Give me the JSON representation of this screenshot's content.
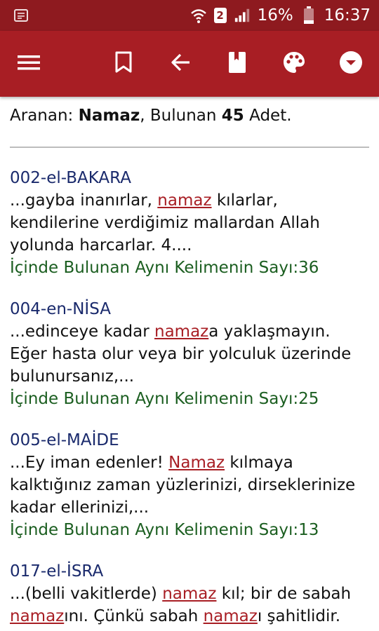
{
  "status_bar": {
    "battery": "16%",
    "time": "16:37",
    "sim": "2",
    "icons": [
      "notification-icon",
      "wifi-icon",
      "signal-icon",
      "battery-icon"
    ]
  },
  "toolbar": {
    "icons": [
      "menu-icon",
      "bookmark-icon",
      "back-arrow-icon",
      "book-icon",
      "palette-icon",
      "dropdown-icon"
    ]
  },
  "search": {
    "label_searched": "Aranan:",
    "term": "Namaz",
    "label_found": ", Bulunan",
    "count": "45",
    "unit": "Adet."
  },
  "results": [
    {
      "title": "002-el-BAKARA",
      "text": [
        {
          "t": "...gayba inanırlar, ",
          "h": false
        },
        {
          "t": "namaz",
          "h": true
        },
        {
          "t": " kılarlar, kendilerine verdiğimiz mallardan Allah yolunda harcarlar. 4....",
          "h": false
        }
      ],
      "count": "İçinde Bulunan Aynı Kelimenin Sayı:36"
    },
    {
      "title": "004-en-NİSA",
      "text": [
        {
          "t": "...edinceye kadar ",
          "h": false
        },
        {
          "t": "namaz",
          "h": true
        },
        {
          "t": "a yaklaşmayın. Eğer hasta olur veya bir yolculuk üzerinde bulunursanız,...",
          "h": false
        }
      ],
      "count": "İçinde Bulunan Aynı Kelimenin Sayı:25"
    },
    {
      "title": "005-el-MAİDE",
      "text": [
        {
          "t": "...Ey iman edenler! ",
          "h": false
        },
        {
          "t": "Namaz",
          "h": true
        },
        {
          "t": " kılmaya kalktığınız zaman yüzlerinizi, dirseklerinize kadar ellerinizi,...",
          "h": false
        }
      ],
      "count": "İçinde Bulunan Aynı Kelimenin Sayı:13"
    },
    {
      "title": "017-el-İSRA",
      "text": [
        {
          "t": "...(belli vakitlerde) ",
          "h": false
        },
        {
          "t": "namaz",
          "h": true
        },
        {
          "t": " kıl; bir de sabah ",
          "h": false
        },
        {
          "t": "namaz",
          "h": true
        },
        {
          "t": "ını. Çünkü sabah ",
          "h": false
        },
        {
          "t": "namaz",
          "h": true
        },
        {
          "t": "ı şahitlidir.",
          "h": false
        }
      ],
      "count": ""
    }
  ],
  "colors": {
    "status_bar": "#8e1a1f",
    "toolbar": "#a81e24",
    "title": "#1a2a6c",
    "count": "#1b5e20",
    "highlight": "#a81e24"
  }
}
